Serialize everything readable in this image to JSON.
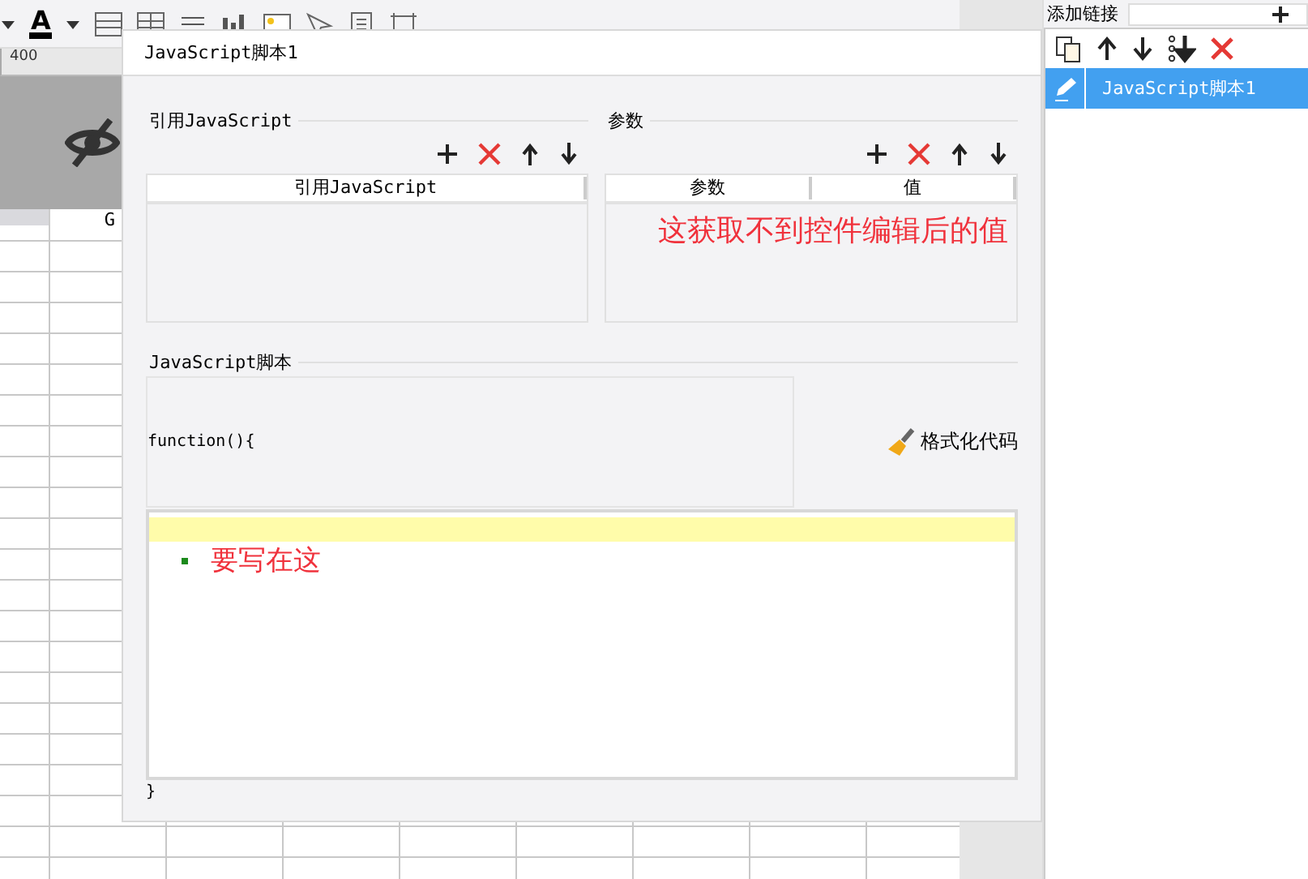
{
  "toolbar": {
    "font_color_label": "A"
  },
  "ruler": {
    "label": "400"
  },
  "sheet": {
    "column_header": "G"
  },
  "right_panel": {
    "title": "添加链接",
    "items": [
      {
        "label": "JavaScript脚本1",
        "selected": true
      }
    ]
  },
  "dialog": {
    "title": "JavaScript脚本1",
    "references": {
      "legend": "引用JavaScript",
      "columns": [
        "引用JavaScript"
      ]
    },
    "params": {
      "legend": "参数",
      "columns": [
        "参数",
        "值"
      ]
    },
    "annotation": "这获取不到控件编辑后的值",
    "script": {
      "legend": "JavaScript脚本",
      "header": "function(){",
      "format_button": "格式化代码",
      "note": "要写在这",
      "footer": "}"
    }
  }
}
